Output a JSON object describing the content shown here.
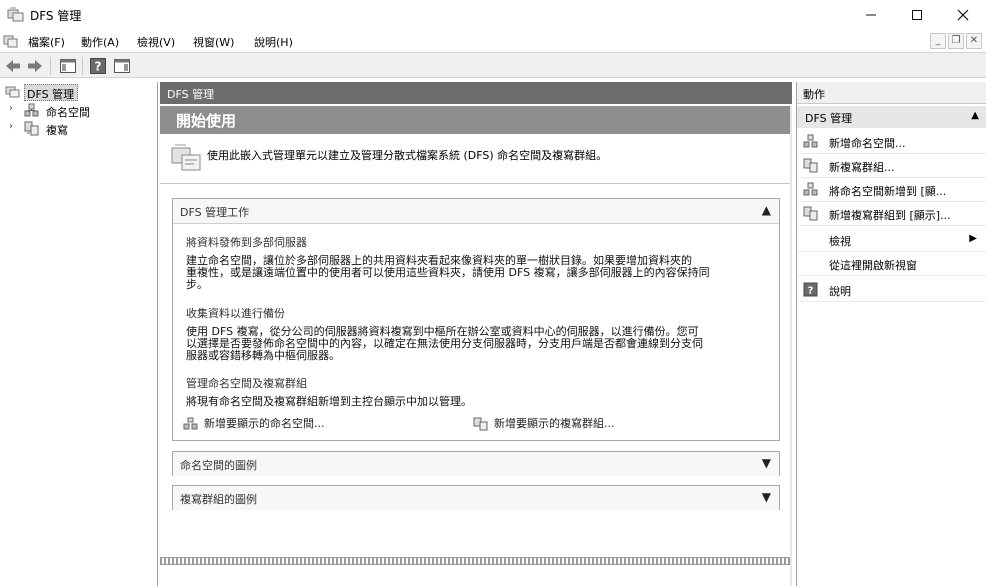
{
  "window": {
    "title": "DFS 管理"
  },
  "menu": {
    "items": [
      "檔案(F)",
      "動作(A)",
      "檢視(V)",
      "視窗(W)",
      "說明(H)"
    ]
  },
  "tree": {
    "root": "DFS 管理",
    "children": [
      "命名空間",
      "複寫"
    ]
  },
  "center": {
    "header": "DFS 管理",
    "banner": "開始使用",
    "intro": "使用此嵌入式管理單元以建立及管理分散式檔案系統 (DFS) 命名空間及複寫群組。",
    "tasks_panel": {
      "title": "DFS 管理工作",
      "sections": [
        {
          "title": "將資料發佈到多部伺服器",
          "lines": [
            "建立命名空間，讓位於多部伺服器上的共用資料夾看起來像資料夾的單一樹狀目錄。如果要增加資料夾的",
            "重複性，或是讓遠端位置中的使用者可以使用這些資料夾，請使用 DFS 複寫，讓多部伺服器上的內容保持同",
            "步。"
          ]
        },
        {
          "title": "收集資料以進行備份",
          "lines": [
            "使用 DFS 複寫，從分公司的伺服器將資料複寫到中樞所在辦公室或資料中心的伺服器，以進行備份。您可",
            "以選擇是否要發佈命名空間中的內容，以確定在無法使用分支伺服器時，分支用戶端是否都會連線到分支伺",
            "服器或容錯移轉為中樞伺服器。"
          ]
        },
        {
          "title": "管理命名空間及複寫群組",
          "lines": [
            "將現有命名空間及複寫群組新增到主控台顯示中加以管理。"
          ]
        }
      ],
      "links": [
        "新增要顯示的命名空間...",
        "新增要顯示的複寫群組..."
      ]
    },
    "namespace_legend": "命名空間的圖例",
    "replication_legend": "複寫群組的圖例"
  },
  "actions": {
    "header": "動作",
    "group": "DFS 管理",
    "items": [
      "新增命名空間...",
      "新複寫群組...",
      "將命名空間新增到 [顯...",
      "新增複寫群組到 [顯示]...",
      "檢視",
      "從這裡開啟新視窗",
      "說明"
    ]
  },
  "icons": {
    "back": "back-arrow-icon",
    "forward": "forward-arrow-icon",
    "console-tree": "console-tree-icon",
    "help": "help-icon",
    "action-pane": "action-pane-icon"
  }
}
